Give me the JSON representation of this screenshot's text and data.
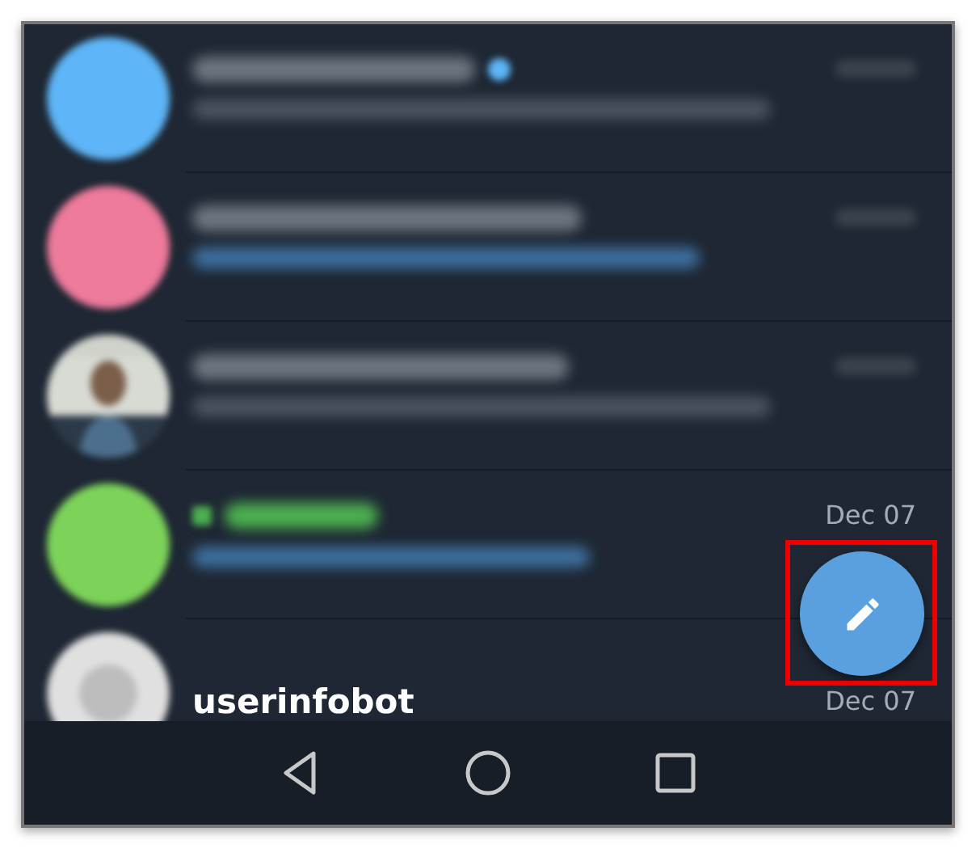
{
  "chats": [
    {
      "avatar": {
        "kind": "circle",
        "color": "#5eb5f7"
      },
      "verified": true,
      "secret": false,
      "preview_highlighted": false
    },
    {
      "avatar": {
        "kind": "circle",
        "color": "#ee7a9c"
      },
      "verified": false,
      "secret": false,
      "preview_highlighted": true
    },
    {
      "verified": false,
      "secret": false,
      "preview_highlighted": false
    },
    {
      "avatar": {
        "kind": "circle",
        "color": "#7dd35a"
      },
      "verified": false,
      "secret": true,
      "preview_highlighted": true,
      "date": "Dec 07"
    },
    {
      "avatar": {
        "kind": "placeholder"
      },
      "verified": false,
      "secret": false,
      "name": "userinfobot",
      "date": "Dec 07"
    }
  ],
  "fab": {
    "highlighted": true
  },
  "nav": [
    {
      "kind": "back"
    },
    {
      "kind": "home"
    },
    {
      "kind": "recents"
    }
  ]
}
